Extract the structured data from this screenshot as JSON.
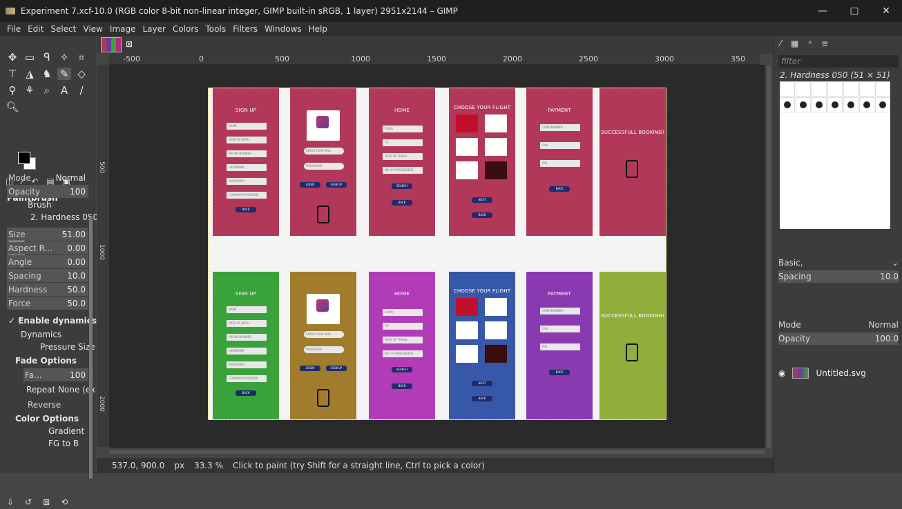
{
  "window": {
    "title": "Experiment 7.xcf-10.0 (RGB color 8-bit non-linear integer, GIMP built-in sRGB, 1 layer) 2951x2144 – GIMP",
    "minimize": "—",
    "maximize": "▢",
    "close": "✕"
  },
  "menu": [
    "File",
    "Edit",
    "Select",
    "View",
    "Image",
    "Layer",
    "Colors",
    "Tools",
    "Filters",
    "Windows",
    "Help"
  ],
  "tool_options": {
    "title": "Paintbrush",
    "mode_label": "Mode",
    "mode_value": "Normal",
    "opacity_label": "Opacity",
    "opacity_value": "100",
    "brush_label": "Brush",
    "brush_value": "2. Hardness 050",
    "size_label": "Size",
    "size_value": "51.00",
    "aspect_label": "Aspect R...",
    "aspect_value": "0.00",
    "angle_label": "Angle",
    "angle_value": "0.00",
    "spacing_label": "Spacing",
    "spacing_value": "10.0",
    "hardness_label": "Hardness",
    "hardness_value": "50.0",
    "force_label": "Force",
    "force_value": "50.0",
    "enable_dynamics": "Enable dynamics",
    "dynamics_label": "Dynamics",
    "dynamics_value": "Pressure Size",
    "fade_options": "Fade Options",
    "fade_label": "Fa...",
    "fade_value": "100",
    "repeat_label": "Repeat",
    "repeat_value": "None (ex",
    "reverse": "Reverse",
    "color_options": "Color Options",
    "gradient_label": "Gradient",
    "gradient_value": "FG to B"
  },
  "ruler_h_ticks": [
    "-500",
    "0",
    "500",
    "1000",
    "1500",
    "2000",
    "2500",
    "3000",
    "350"
  ],
  "ruler_v_ticks": [
    "500",
    "1000",
    "2000"
  ],
  "image_screens_top": [
    {
      "label": "SIGN UP",
      "color": "#b2385a"
    },
    {
      "label": "",
      "color": "#b2385a"
    },
    {
      "label": "HOME",
      "color": "#b2385a"
    },
    {
      "label": "CHOOSE YOUR FLIGHT",
      "color": "#b2385a"
    },
    {
      "label": "PAYMENT",
      "color": "#b2385a"
    },
    {
      "label": "SUCCESSFULL BOOKING!",
      "color": "#b2385a"
    }
  ],
  "image_screens_bottom": [
    {
      "label": "SIGN UP",
      "color": "#3aa23a"
    },
    {
      "label": "",
      "color": "#a07c2c"
    },
    {
      "label": "HOME",
      "color": "#b23cb8"
    },
    {
      "label": "CHOOSE YOUR FLIGHT",
      "color": "#3758a8"
    },
    {
      "label": "PAYMENT",
      "color": "#8a3ab0"
    },
    {
      "label": "SUCCESSFULL BOOKING!",
      "color": "#8fae3a"
    }
  ],
  "signup_fields": [
    "NAME",
    "DATE OF BIRTH",
    "PHONE NUMBER",
    "USERNAME",
    "PASSWORD",
    "CONFIRM PASSWORD"
  ],
  "login_fields": [
    "ENTER YOUR MAIL",
    "PASSWORD"
  ],
  "home_fields": [
    "FROM",
    "TO",
    "DATE OF TRAVEL",
    "NO. OF PASSENGERS"
  ],
  "payment_fields": [
    "CARD NUMBER",
    "CVV",
    "PIN"
  ],
  "buttons": {
    "back": "BACK",
    "login": "LOGIN",
    "signup": "SIGN UP",
    "search": "SEARCH",
    "next": "NEXT"
  },
  "dock": {
    "filter_placeholder": "filter",
    "brush_name": "2. Hardness 050 (51 × 51)",
    "preset": "Basic,",
    "spacing_label": "Spacing",
    "spacing_value": "10.0",
    "mode_label": "Mode",
    "mode_value": "Normal",
    "opacity_label": "Opacity",
    "opacity_value": "100.0",
    "layer_name": "Untitled.svg"
  },
  "status": {
    "coords": "537.0, 900.0",
    "unit": "px",
    "zoom": "33.3 %",
    "message": "Click to paint (try Shift for a straight line, Ctrl to pick a color)"
  }
}
